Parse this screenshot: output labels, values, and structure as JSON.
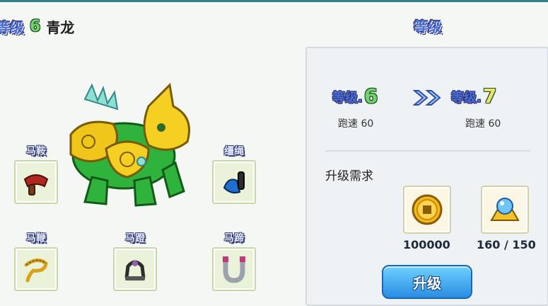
{
  "pet": {
    "level_label": "等级",
    "level": "6",
    "name": "青龙"
  },
  "equipment": {
    "saddle": "马鞍",
    "reins": "缰绳",
    "whip": "马鞭",
    "stirrup": "马蹬",
    "horseshoe": "马蹄"
  },
  "upgrade_panel": {
    "title": "等级",
    "current": {
      "label": "等级.",
      "level": "6",
      "speed": "跑速 60"
    },
    "next": {
      "label": "等级.",
      "level": "7",
      "speed": "跑速 60"
    },
    "requirement_label": "升级需求",
    "items": [
      {
        "icon": "gold-coin-icon",
        "count": "100000"
      },
      {
        "icon": "crystal-stone-icon",
        "count": "160 / 150"
      }
    ],
    "button_label": "升级"
  },
  "colors": {
    "level_blue": "#4b6fd8",
    "level_green": "#6fd36b",
    "button_blue": "#2a8de3"
  }
}
